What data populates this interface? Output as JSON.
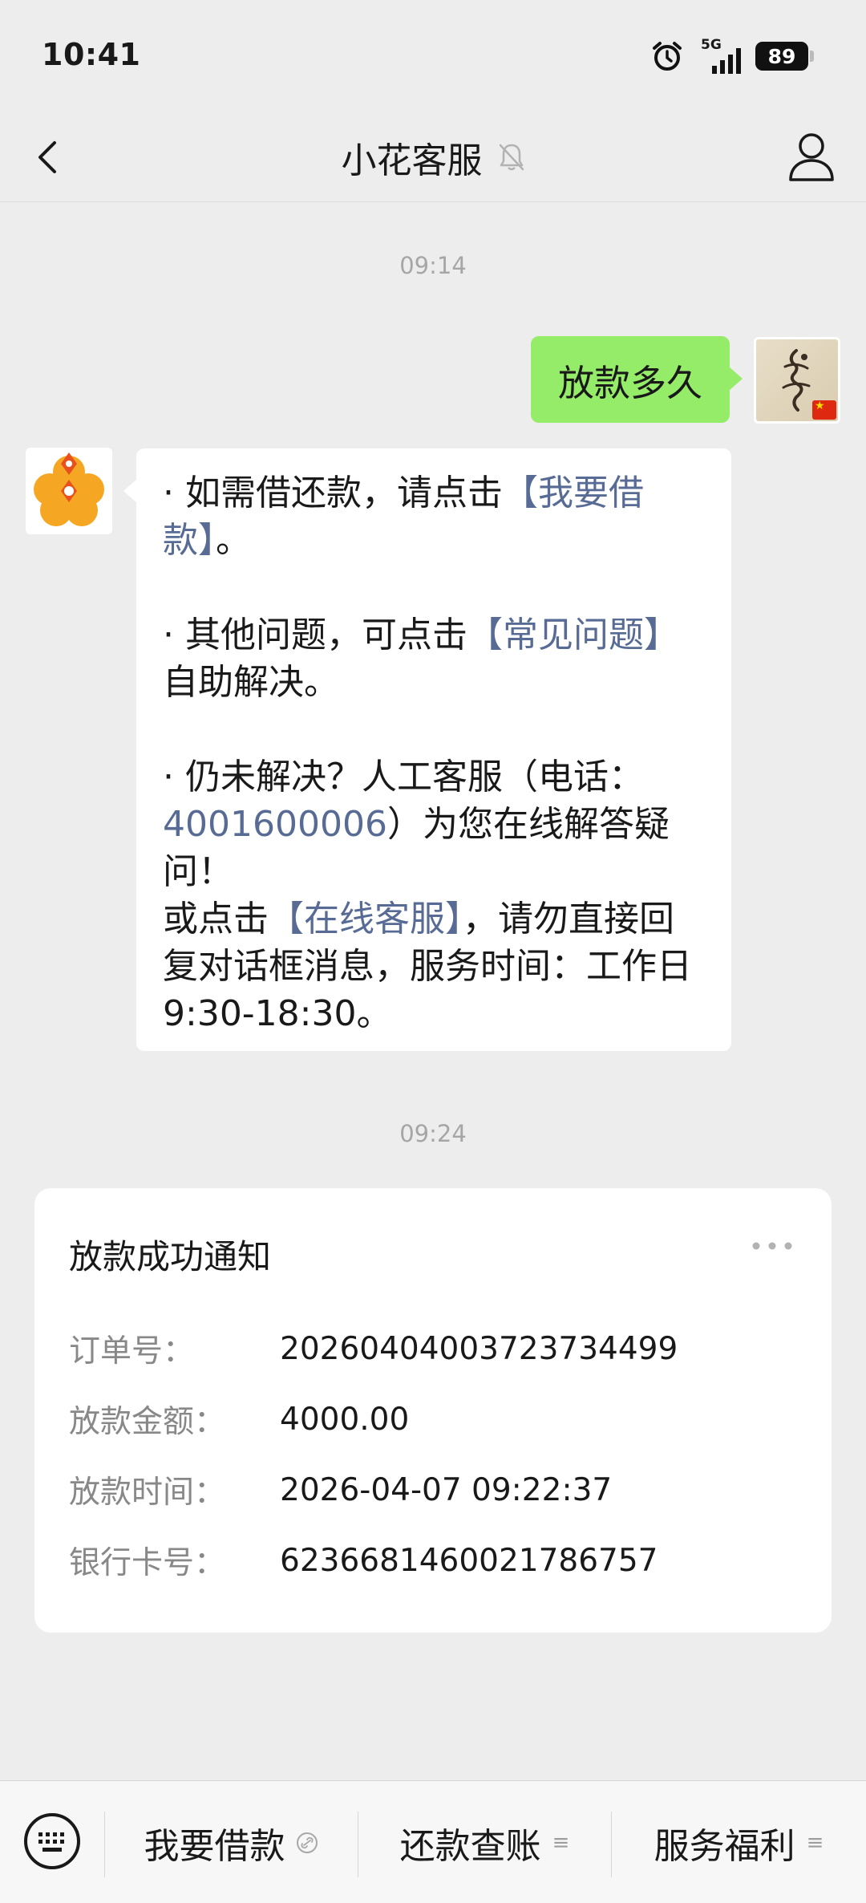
{
  "status_bar": {
    "time": "10:41",
    "network": "5G",
    "battery": "89"
  },
  "nav": {
    "title": "小花客服"
  },
  "chat": {
    "time_1": "09:14",
    "outgoing_message": "放款多久",
    "reply": {
      "p1_prefix": "· 如需借还款，请点击",
      "p1_link": "【我要借款】",
      "p1_suffix": "。",
      "p2_prefix": "· 其他问题，可点击",
      "p2_link": "【常见问题】",
      "p2_suffix": "自助解决。",
      "p3_prefix": "· 仍未解决？人工客服（电话：",
      "p3_phone": "4001600006",
      "p3_suffix": "）为您在线解答疑问！",
      "p4_prefix": "或点击",
      "p4_link": "【在线客服】",
      "p4_suffix": "，请勿直接回复对话框消息，服务时间：工作日9:30-18:30。"
    },
    "time_2": "09:24"
  },
  "notice": {
    "title": "放款成功通知",
    "rows": [
      {
        "label": "订单号：",
        "value": "20260404003723734499"
      },
      {
        "label": "放款金额：",
        "value": "4000.00"
      },
      {
        "label": "放款时间：",
        "value": "2026-04-07 09:22:37"
      },
      {
        "label": "银行卡号：",
        "value": "6236681460021786757"
      }
    ]
  },
  "bottom_menu": {
    "items": [
      {
        "label": "我要借款",
        "icon": "link-icon"
      },
      {
        "label": "还款查账",
        "icon": "submenu-icon"
      },
      {
        "label": "服务福利",
        "icon": "submenu-icon"
      }
    ]
  },
  "colors": {
    "background": "#ededed",
    "outgoing_bubble": "#95ec69",
    "link": "#576b95",
    "brand_orange": "#f5a623",
    "brand_red": "#e8501e"
  }
}
